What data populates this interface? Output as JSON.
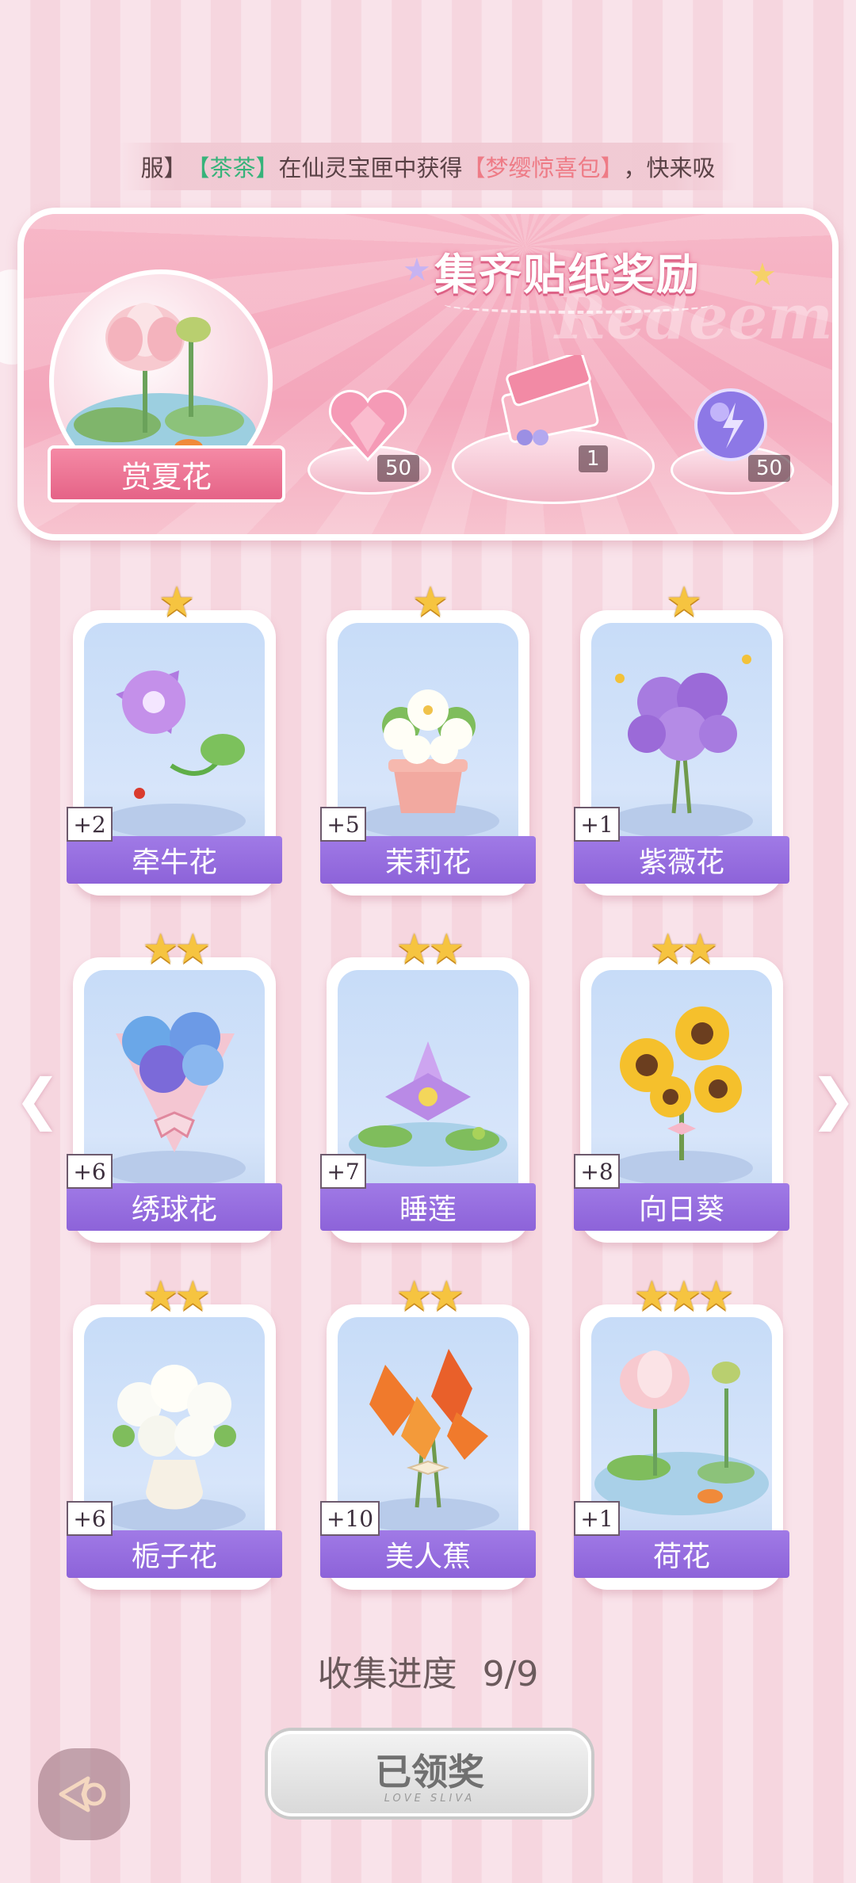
{
  "marquee": {
    "part1": "服】",
    "player": "【茶茶】",
    "middle": "在仙灵宝匣中获得",
    "item": "【梦缨惊喜包】",
    "end": "，快来吸"
  },
  "banner": {
    "title": "集齐贴纸奖励",
    "watermark": "Redeem",
    "set_name": "赏夏花",
    "rewards": [
      {
        "icon": "pink-heart-gem-icon",
        "count": "50"
      },
      {
        "icon": "gift-box-icon",
        "count": "1"
      },
      {
        "icon": "purple-energy-orb-icon",
        "count": "50"
      }
    ]
  },
  "cards": [
    {
      "name": "牵牛花",
      "bonus": "+2",
      "stars": "★",
      "icon": "morning-glory-icon"
    },
    {
      "name": "茉莉花",
      "bonus": "+5",
      "stars": "★",
      "icon": "jasmine-pot-icon"
    },
    {
      "name": "紫薇花",
      "bonus": "+1",
      "stars": "★",
      "icon": "crape-myrtle-bouquet-icon"
    },
    {
      "name": "绣球花",
      "bonus": "+6",
      "stars": "★★",
      "icon": "hydrangea-bouquet-icon"
    },
    {
      "name": "睡莲",
      "bonus": "+7",
      "stars": "★★",
      "icon": "water-lily-icon"
    },
    {
      "name": "向日葵",
      "bonus": "+8",
      "stars": "★★",
      "icon": "sunflower-bouquet-icon"
    },
    {
      "name": "栀子花",
      "bonus": "+6",
      "stars": "★★",
      "icon": "gardenia-vase-icon"
    },
    {
      "name": "美人蕉",
      "bonus": "+10",
      "stars": "★★",
      "icon": "canna-bouquet-icon"
    },
    {
      "name": "荷花",
      "bonus": "+1",
      "stars": "★★★",
      "icon": "lotus-pond-icon"
    }
  ],
  "progress": {
    "label": "收集进度",
    "value": "9/9"
  },
  "claim_button": {
    "label": "已领奖",
    "sub": "LOVE SLIVA"
  },
  "colors": {
    "accent_purple": "#9470e0",
    "banner_pink": "#f4a6bb",
    "star_gold": "#f6c440"
  }
}
